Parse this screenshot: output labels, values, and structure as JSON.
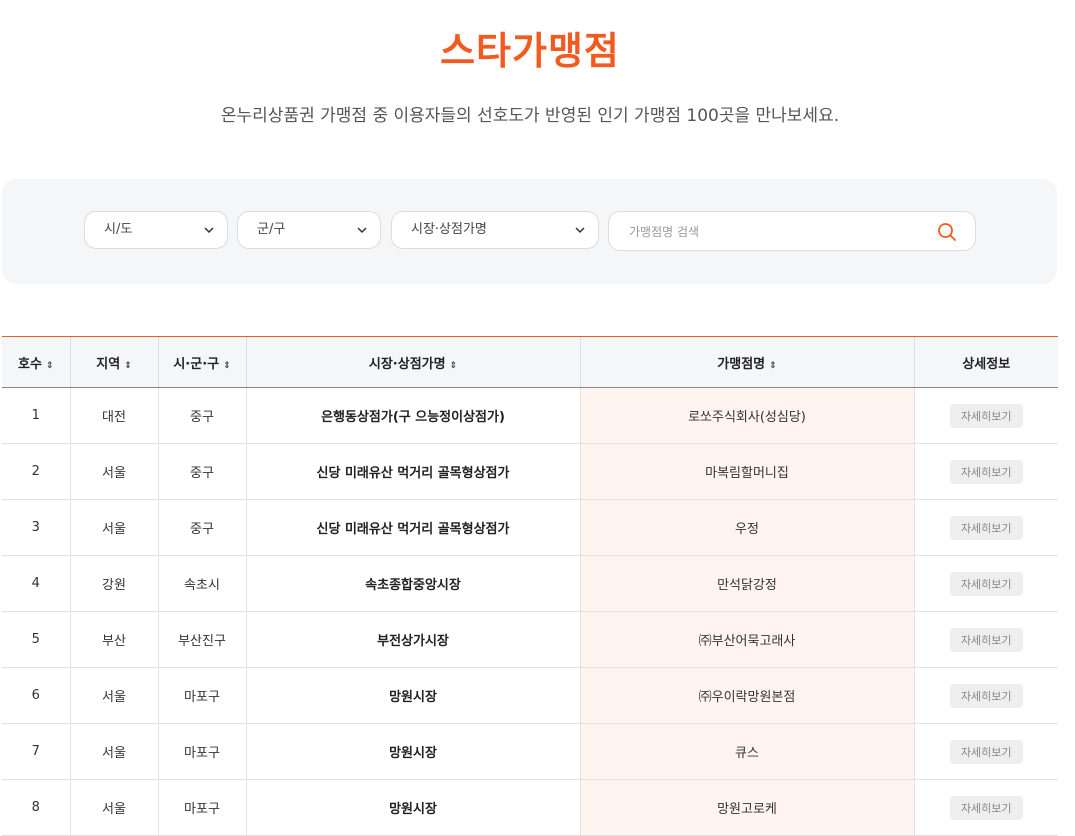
{
  "header": {
    "title": "스타가맹점",
    "subtitle": "온누리상품권 가맹점 중 이용자들의 선호도가 반영된 인기 가맹점 100곳을 만나보세요."
  },
  "filters": {
    "province": "시/도",
    "district": "군/구",
    "market": "시장·상점가명",
    "search_placeholder": "가맹점명 검색",
    "search_value": ""
  },
  "table": {
    "columns": [
      "호수",
      "지역",
      "시·군·구",
      "시장·상점가명",
      "가맹점명",
      "상세정보"
    ],
    "sortable": [
      true,
      true,
      true,
      true,
      true,
      false
    ],
    "rows": [
      {
        "no": "1",
        "region": "대전",
        "district": "중구",
        "market": "은행동상점가(구 으능정이상점가)",
        "store": "로쏘주식회사(성심당)",
        "detail": "자세히보기"
      },
      {
        "no": "2",
        "region": "서울",
        "district": "중구",
        "market": "신당 미래유산 먹거리 골목형상점가",
        "store": "마복림할머니집",
        "detail": "자세히보기"
      },
      {
        "no": "3",
        "region": "서울",
        "district": "중구",
        "market": "신당 미래유산 먹거리 골목형상점가",
        "store": "우정",
        "detail": "자세히보기"
      },
      {
        "no": "4",
        "region": "강원",
        "district": "속초시",
        "market": "속초종합중앙시장",
        "store": "만석닭강정",
        "detail": "자세히보기"
      },
      {
        "no": "5",
        "region": "부산",
        "district": "부산진구",
        "market": "부전상가시장",
        "store": "㈜부산어묵고래사",
        "detail": "자세히보기"
      },
      {
        "no": "6",
        "region": "서울",
        "district": "마포구",
        "market": "망원시장",
        "store": "㈜우이락망원본점",
        "detail": "자세히보기"
      },
      {
        "no": "7",
        "region": "서울",
        "district": "마포구",
        "market": "망원시장",
        "store": "큐스",
        "detail": "자세히보기"
      },
      {
        "no": "8",
        "region": "서울",
        "district": "마포구",
        "market": "망원시장",
        "store": "망원고로케",
        "detail": "자세히보기"
      }
    ]
  },
  "colors": {
    "accent": "#f25a1f",
    "store_column_bg": "#fff4f0",
    "panel_bg": "#f5f6f8"
  }
}
